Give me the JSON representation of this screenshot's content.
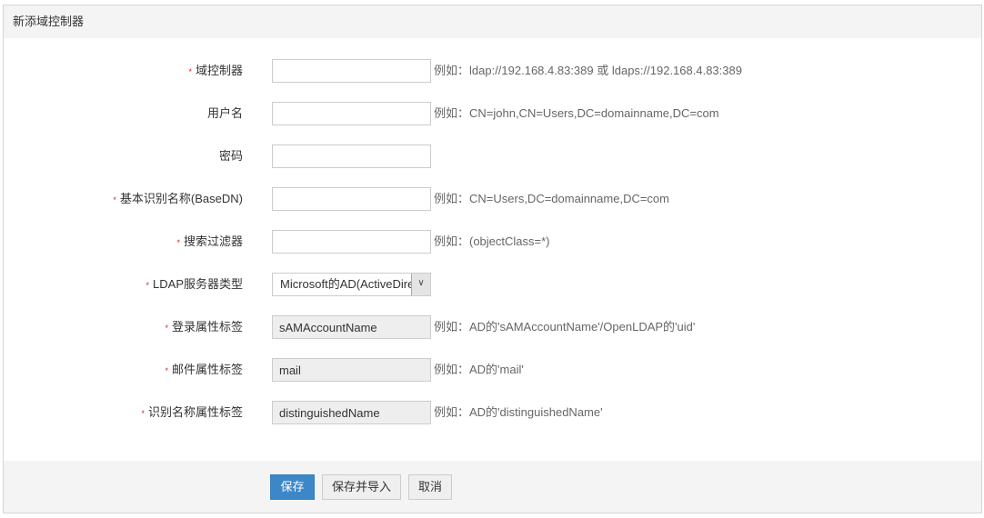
{
  "title": "新添域控制器",
  "fields": [
    {
      "label": "域控制器",
      "required": true,
      "value": "",
      "hint": "例如：ldap://192.168.4.83:389 或 ldaps://192.168.4.83:389"
    },
    {
      "label": "用户名",
      "required": false,
      "value": "",
      "hint": "例如：CN=john,CN=Users,DC=domainname,DC=com"
    },
    {
      "label": "密码",
      "required": false,
      "value": "",
      "hint": ""
    },
    {
      "label": "基本识别名称(BaseDN)",
      "required": true,
      "value": "",
      "hint": "例如：CN=Users,DC=domainname,DC=com"
    },
    {
      "label": "搜索过滤器",
      "required": true,
      "value": "",
      "hint": "例如：(objectClass=*)"
    },
    {
      "label": "LDAP服务器类型",
      "required": true,
      "value": "Microsoft的AD(ActiveDirectory)",
      "hint": ""
    },
    {
      "label": "登录属性标签",
      "required": true,
      "value": "sAMAccountName",
      "hint": "例如：AD的'sAMAccountName'/OpenLDAP的'uid'"
    },
    {
      "label": "邮件属性标签",
      "required": true,
      "value": "mail",
      "hint": "例如：AD的'mail'"
    },
    {
      "label": "识别名称属性标签",
      "required": true,
      "value": "distinguishedName",
      "hint": "例如：AD的'distinguishedName'"
    }
  ],
  "buttons": {
    "save": "保存",
    "save_import": "保存并导入",
    "cancel": "取消"
  },
  "required_mark": "*"
}
